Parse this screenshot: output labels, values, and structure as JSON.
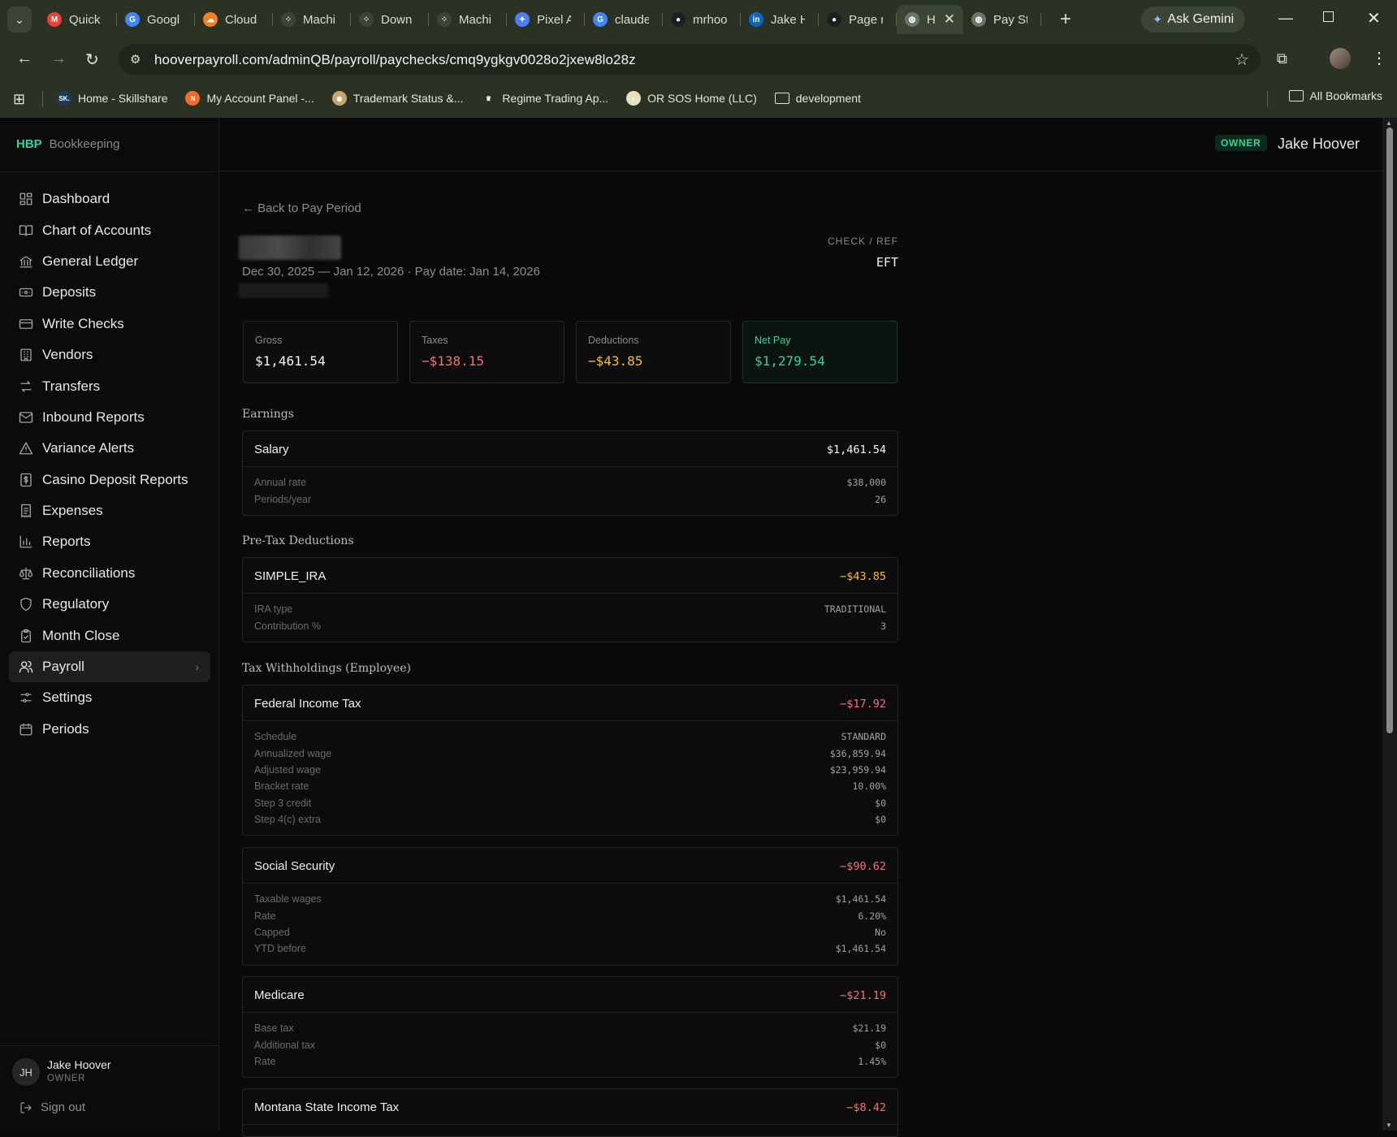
{
  "browser": {
    "tabs": [
      {
        "label": "Quick",
        "fav": "M",
        "color": "#ea4335"
      },
      {
        "label": "Googl",
        "fav": "G",
        "color": "#4285f4"
      },
      {
        "label": "Cloud",
        "fav": "☁",
        "color": "#f48120"
      },
      {
        "label": "Machi",
        "fav": "⁘",
        "color": "#3b4533"
      },
      {
        "label": "Down",
        "fav": "⁘",
        "color": "#3b4533"
      },
      {
        "label": "Machi",
        "fav": "⁘",
        "color": "#3b4533"
      },
      {
        "label": "Pixel A",
        "fav": "✦",
        "color": "#4f7cff"
      },
      {
        "label": "claude",
        "fav": "G",
        "color": "#4285f4"
      },
      {
        "label": "mrhoo",
        "fav": "●",
        "color": "#1b1f23"
      },
      {
        "label": "Jake H",
        "fav": "in",
        "color": "#0a66c2"
      },
      {
        "label": "Page r",
        "fav": "●",
        "color": "#1b1f23"
      },
      {
        "label": "H",
        "fav": "◍",
        "color": "#6b7468",
        "active": true
      },
      {
        "label": "Pay St",
        "fav": "◍",
        "color": "#6b7468"
      }
    ],
    "gemini_label": "Ask Gemini",
    "url": "hooverpayroll.com/adminQB/payroll/paychecks/cmq9ygkgv0028o2jxew8lo28z",
    "bookmarks": [
      {
        "label": "Home - Skillshare",
        "fav": "SK.",
        "color": "#1c3b5a"
      },
      {
        "label": "My Account Panel -...",
        "fav": "N",
        "color": "#f56b2a"
      },
      {
        "label": "Trademark Status &...",
        "fav": "◉",
        "color": "#c8a46b"
      },
      {
        "label": "Regime Trading Ap...",
        "fav": "♛",
        "color": "#2a3224"
      },
      {
        "label": "OR SOS Home (LLC)",
        "fav": "◐",
        "color": "#e8e2c0"
      },
      {
        "label": "development",
        "fav": "folder",
        "color": ""
      }
    ],
    "all_bookmarks": "All Bookmarks"
  },
  "sidebar": {
    "brand_mark": "HBP",
    "brand_name": "Bookkeeping",
    "items": [
      {
        "label": "Dashboard",
        "icon": "dashboard-icon"
      },
      {
        "label": "Chart of Accounts",
        "icon": "book-icon"
      },
      {
        "label": "General Ledger",
        "icon": "bank-icon"
      },
      {
        "label": "Deposits",
        "icon": "deposit-icon"
      },
      {
        "label": "Write Checks",
        "icon": "card-icon"
      },
      {
        "label": "Vendors",
        "icon": "building-icon"
      },
      {
        "label": "Transfers",
        "icon": "transfer-icon"
      },
      {
        "label": "Inbound Reports",
        "icon": "mail-icon"
      },
      {
        "label": "Variance Alerts",
        "icon": "alert-icon"
      },
      {
        "label": "Casino Deposit Reports",
        "icon": "dollar-file-icon"
      },
      {
        "label": "Expenses",
        "icon": "receipt-icon"
      },
      {
        "label": "Reports",
        "icon": "bar-chart-icon"
      },
      {
        "label": "Reconciliations",
        "icon": "scale-icon"
      },
      {
        "label": "Regulatory",
        "icon": "shield-icon"
      },
      {
        "label": "Month Close",
        "icon": "clipboard-check-icon"
      },
      {
        "label": "Payroll",
        "icon": "users-icon",
        "active": true
      },
      {
        "label": "Settings",
        "icon": "sliders-icon"
      },
      {
        "label": "Periods",
        "icon": "calendar-icon"
      }
    ],
    "user": {
      "initials": "JH",
      "name": "Jake Hoover",
      "role": "OWNER"
    },
    "signout": "Sign out"
  },
  "topbar": {
    "badge": "OWNER",
    "user": "Jake Hoover"
  },
  "paycheck": {
    "back": "← Back to Pay Period",
    "period": "Dec 30, 2025 — Jan 12, 2026 · Pay date: Jan 14, 2026",
    "check_ref_label": "CHECK / REF",
    "check_ref_value": "EFT",
    "summary": {
      "gross": {
        "label": "Gross",
        "value": "$1,461.54"
      },
      "taxes": {
        "label": "Taxes",
        "value": "−$138.15"
      },
      "deductions": {
        "label": "Deductions",
        "value": "−$43.85"
      },
      "net": {
        "label": "Net Pay",
        "value": "$1,279.54"
      }
    },
    "sections": {
      "earnings": "Earnings",
      "pretax": "Pre-Tax Deductions",
      "tax": "Tax Withholdings (Employee)"
    },
    "salary": {
      "title": "Salary",
      "amount": "$1,461.54",
      "rows": [
        [
          "Annual rate",
          "$38,000"
        ],
        [
          "Periods/year",
          "26"
        ]
      ]
    },
    "ira": {
      "title": "SIMPLE_IRA",
      "amount": "−$43.85",
      "rows": [
        [
          "IRA type",
          "TRADITIONAL"
        ],
        [
          "Contribution %",
          "3"
        ]
      ]
    },
    "fit": {
      "title": "Federal Income Tax",
      "amount": "−$17.92",
      "rows": [
        [
          "Schedule",
          "STANDARD"
        ],
        [
          "Annualized wage",
          "$36,859.94"
        ],
        [
          "Adjusted wage",
          "$23,959.94"
        ],
        [
          "Bracket rate",
          "10.00%"
        ],
        [
          "Step 3 credit",
          "$0"
        ],
        [
          "Step 4(c) extra",
          "$0"
        ]
      ]
    },
    "ss": {
      "title": "Social Security",
      "amount": "−$90.62",
      "rows": [
        [
          "Taxable wages",
          "$1,461.54"
        ],
        [
          "Rate",
          "6.20%"
        ],
        [
          "Capped",
          "No"
        ],
        [
          "YTD before",
          "$1,461.54"
        ]
      ]
    },
    "medicare": {
      "title": "Medicare",
      "amount": "−$21.19",
      "rows": [
        [
          "Base tax",
          "$21.19"
        ],
        [
          "Additional tax",
          "$0"
        ],
        [
          "Rate",
          "1.45%"
        ]
      ]
    },
    "montana": {
      "title": "Montana State Income Tax",
      "amount": "−$8.42",
      "rows": []
    }
  }
}
